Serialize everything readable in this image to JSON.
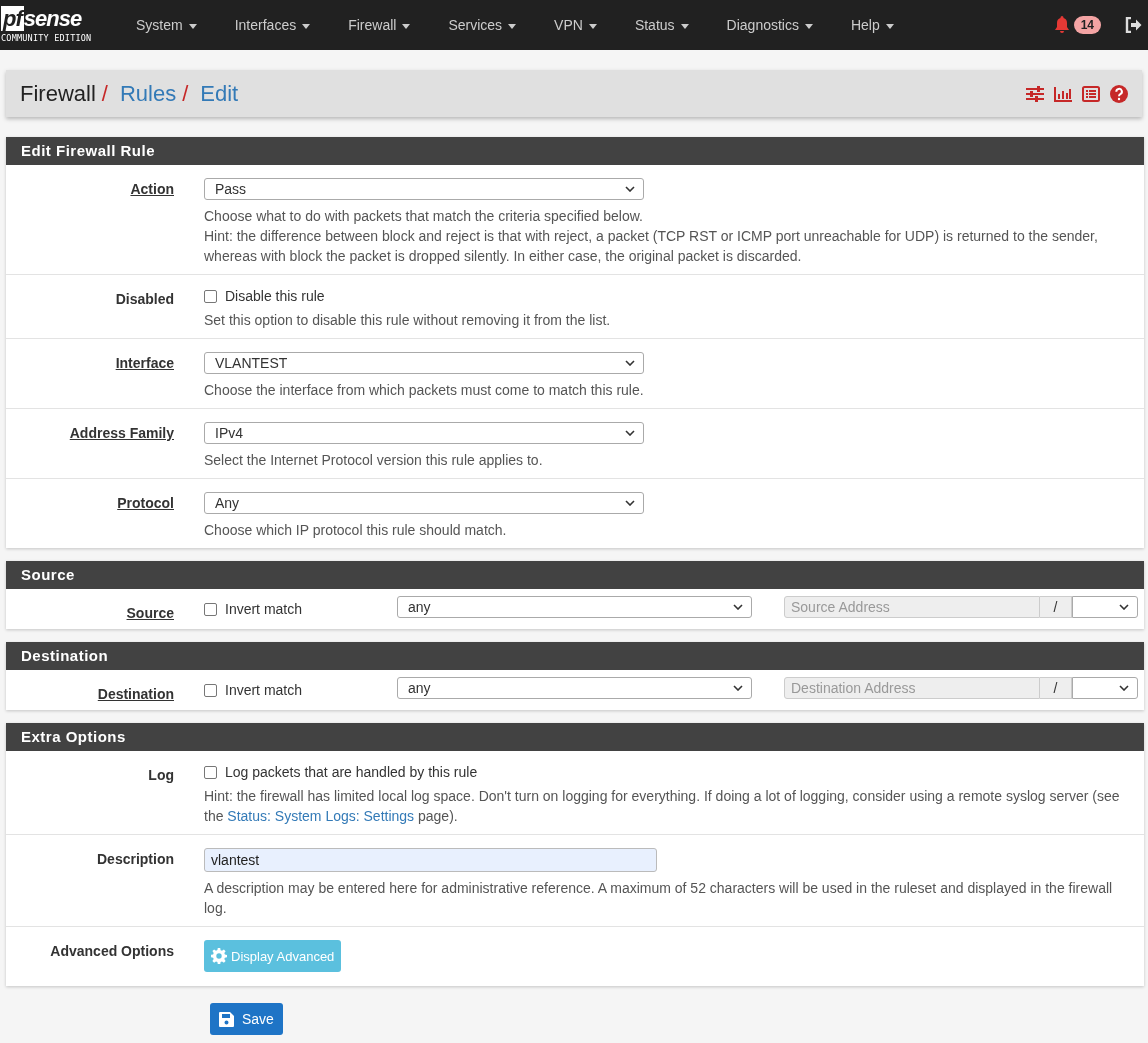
{
  "navbar": {
    "brand": {
      "logo_prefix": "pf",
      "logo_suffix": "sense",
      "edition": "COMMUNITY EDITION"
    },
    "menus": [
      "System",
      "Interfaces",
      "Firewall",
      "Services",
      "VPN",
      "Status",
      "Diagnostics",
      "Help"
    ],
    "notifications": {
      "count": "14"
    }
  },
  "breadcrumb": [
    {
      "label": "Firewall",
      "link": false,
      "separator": "/"
    },
    {
      "label": "Rules",
      "link": true,
      "separator": "/"
    },
    {
      "label": "Edit",
      "link": true
    }
  ],
  "sections": [
    {
      "title": "Edit Firewall Rule",
      "rows": [
        {
          "kind": "select",
          "label": "Action",
          "underlined": true,
          "value": "Pass",
          "help": [
            {
              "text": "Choose what to do with packets that match the criteria specified below."
            },
            {
              "text": "Hint: the difference between block and reject is that with reject, a packet (TCP RST or ICMP port unreachable for UDP) is returned to the sender, whereas with block the packet is dropped silently. In either case, the original packet is discarded."
            }
          ]
        },
        {
          "kind": "checkbox",
          "label": "Disabled",
          "underlined": false,
          "checkbox_label": "Disable this rule",
          "checked": false,
          "help": [
            {
              "text": "Set this option to disable this rule without removing it from the list."
            }
          ]
        },
        {
          "kind": "select",
          "label": "Interface",
          "underlined": true,
          "value": "VLANTEST",
          "help": [
            {
              "text": "Choose the interface from which packets must come to match this rule."
            }
          ]
        },
        {
          "kind": "select",
          "label": "Address Family",
          "underlined": true,
          "value": "IPv4",
          "help": [
            {
              "text": "Select the Internet Protocol version this rule applies to."
            }
          ]
        },
        {
          "kind": "select",
          "label": "Protocol",
          "underlined": true,
          "value": "Any",
          "help": [
            {
              "text": "Choose which IP protocol this rule should match."
            }
          ]
        }
      ]
    },
    {
      "title": "Source",
      "rows": [
        {
          "kind": "address",
          "label": "Source",
          "underlined": true,
          "checkbox_label": "Invert match",
          "checked": false,
          "value": "any",
          "placeholder": "Source Address",
          "separator": "/"
        }
      ]
    },
    {
      "title": "Destination",
      "rows": [
        {
          "kind": "address",
          "label": "Destination",
          "underlined": true,
          "checkbox_label": "Invert match",
          "checked": false,
          "value": "any",
          "placeholder": "Destination Address",
          "separator": "/"
        }
      ]
    },
    {
      "title": "Extra Options",
      "rows": [
        {
          "kind": "checkbox",
          "label": "Log",
          "underlined": false,
          "checkbox_label": "Log packets that are handled by this rule",
          "checked": false,
          "help": [
            {
              "text": "Hint: the firewall has limited local log space. Don't turn on logging for everything. If doing a lot of logging, consider using a remote syslog server (see the ",
              "link": "Status: System Logs: Settings",
              "after": " page)."
            }
          ]
        },
        {
          "kind": "text",
          "label": "Description",
          "underlined": false,
          "value": "vlantest",
          "help": [
            {
              "text": "A description may be entered here for administrative reference. A maximum of 52 characters will be used in the ruleset and displayed in the firewall log."
            }
          ]
        },
        {
          "kind": "button",
          "label": "Advanced Options",
          "underlined": false,
          "button": "Display Advanced"
        }
      ]
    }
  ],
  "save_button": "Save"
}
